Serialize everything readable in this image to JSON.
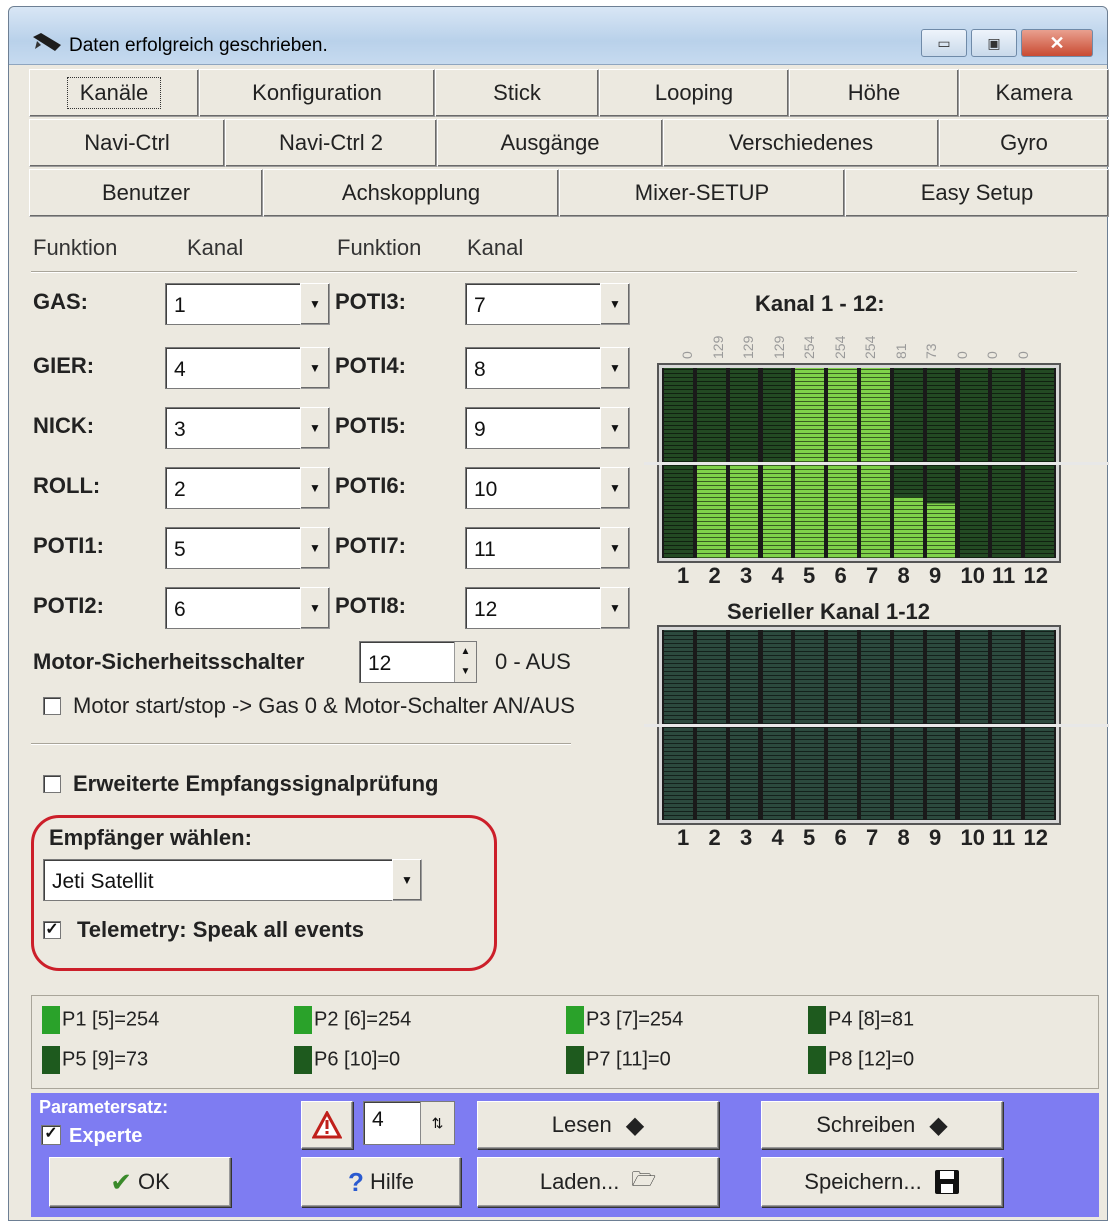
{
  "title": "Daten erfolgreich geschrieben.",
  "tabs": {
    "row1": [
      "Kanäle",
      "Konfiguration",
      "Stick",
      "Looping",
      "Höhe",
      "Kamera"
    ],
    "row2": [
      "Navi-Ctrl",
      "Navi-Ctrl 2",
      "Ausgänge",
      "Verschiedenes",
      "Gyro"
    ],
    "row3": [
      "Benutzer",
      "Achskopplung",
      "Mixer-SETUP",
      "Easy Setup"
    ]
  },
  "headers": {
    "funktion1": "Funktion",
    "kanal1": "Kanal",
    "funktion2": "Funktion",
    "kanal2": "Kanal"
  },
  "mapping_left": [
    {
      "label": "GAS:",
      "value": "1"
    },
    {
      "label": "GIER:",
      "value": "4"
    },
    {
      "label": "NICK:",
      "value": "3"
    },
    {
      "label": "ROLL:",
      "value": "2"
    },
    {
      "label": "POTI1:",
      "value": "5"
    },
    {
      "label": "POTI2:",
      "value": "6"
    }
  ],
  "mapping_right": [
    {
      "label": "POTI3:",
      "value": "7"
    },
    {
      "label": "POTI4:",
      "value": "8"
    },
    {
      "label": "POTI5:",
      "value": "9"
    },
    {
      "label": "POTI6:",
      "value": "10"
    },
    {
      "label": "POTI7:",
      "value": "11"
    },
    {
      "label": "POTI8:",
      "value": "12"
    }
  ],
  "motor_switch": {
    "label": "Motor-Sicherheitsschalter",
    "value": "12",
    "hint": "0 - AUS"
  },
  "motor_start_stop": {
    "label": "Motor start/stop -> Gas 0 & Motor-Schalter AN/AUS",
    "checked": false
  },
  "extended_check": {
    "label": "Erweiterte Empfangssignalprüfung",
    "checked": false
  },
  "receiver": {
    "label": "Empfänger wählen:",
    "value": "Jeti Satellit"
  },
  "telemetry": {
    "label": "Telemetry: Speak all events",
    "checked": true
  },
  "channel_panel": {
    "title": "Kanal 1 - 12:",
    "values": [
      "0",
      "129",
      "129",
      "129",
      "254",
      "254",
      "254",
      "81",
      "73",
      "0",
      "0",
      "0"
    ],
    "numbers": [
      "1",
      "2",
      "3",
      "4",
      "5",
      "6",
      "7",
      "8",
      "9",
      "10",
      "11",
      "12"
    ],
    "bar_levels": [
      0,
      129,
      129,
      129,
      254,
      254,
      254,
      81,
      73,
      0,
      0,
      0
    ]
  },
  "serial_panel": {
    "title": "Serieller Kanal 1-12",
    "numbers": [
      "1",
      "2",
      "3",
      "4",
      "5",
      "6",
      "7",
      "8",
      "9",
      "10",
      "11",
      "12"
    ]
  },
  "status": [
    {
      "text": "P1 [5]=254",
      "on": true
    },
    {
      "text": "P2 [6]=254",
      "on": true
    },
    {
      "text": "P3 [7]=254",
      "on": true
    },
    {
      "text": "P4 [8]=81",
      "on": false
    },
    {
      "text": "P5 [9]=73",
      "on": false
    },
    {
      "text": "P6 [10]=0",
      "on": false
    },
    {
      "text": "P7 [11]=0",
      "on": false
    },
    {
      "text": "P8 [12]=0",
      "on": false
    }
  ],
  "bottom": {
    "param_label": "Parametersatz:",
    "expert_label": "Experte",
    "expert_checked": true,
    "param_value": "4",
    "ok": "OK",
    "help": "Hilfe",
    "read": "Lesen",
    "write": "Schreiben",
    "load": "Laden...",
    "save": "Speichern..."
  },
  "colors": {
    "bottom_bg": "#7e7cf2",
    "highlight": "#cc1f2a",
    "led_on": "#2aa22a",
    "led_off": "#1e5a1e"
  }
}
